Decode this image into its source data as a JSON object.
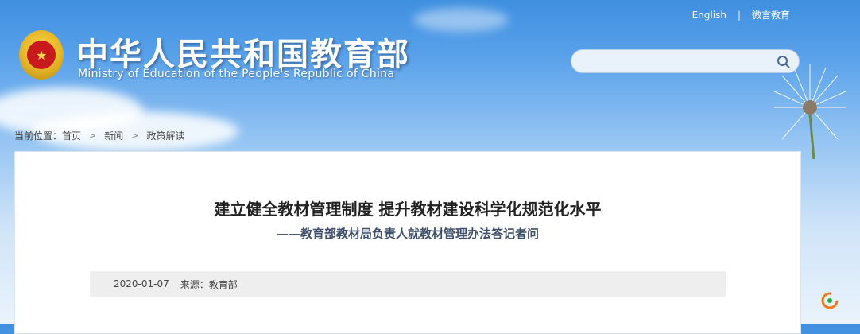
{
  "header": {
    "title": "中华人民共和国教育部",
    "subtitle": "Ministry of Education of the People's Republic of China",
    "links": [
      "English",
      "微言教育"
    ]
  },
  "search": {
    "placeholder": ""
  },
  "breadcrumb": {
    "label": "当前位置：",
    "items": [
      "首页",
      "新闻",
      "政策解读"
    ]
  },
  "article": {
    "title": "建立健全教材管理制度 提升教材建设科学化规范化水平",
    "subtitle": "——教育部教材局负责人就教材管理办法答记者问",
    "date": "2020-01-07",
    "source": "来源：教育部"
  },
  "colors": {
    "sky_top": "#3f8fe0",
    "emblem_red": "#c8191c",
    "accent_orange": "#f07a1a"
  }
}
